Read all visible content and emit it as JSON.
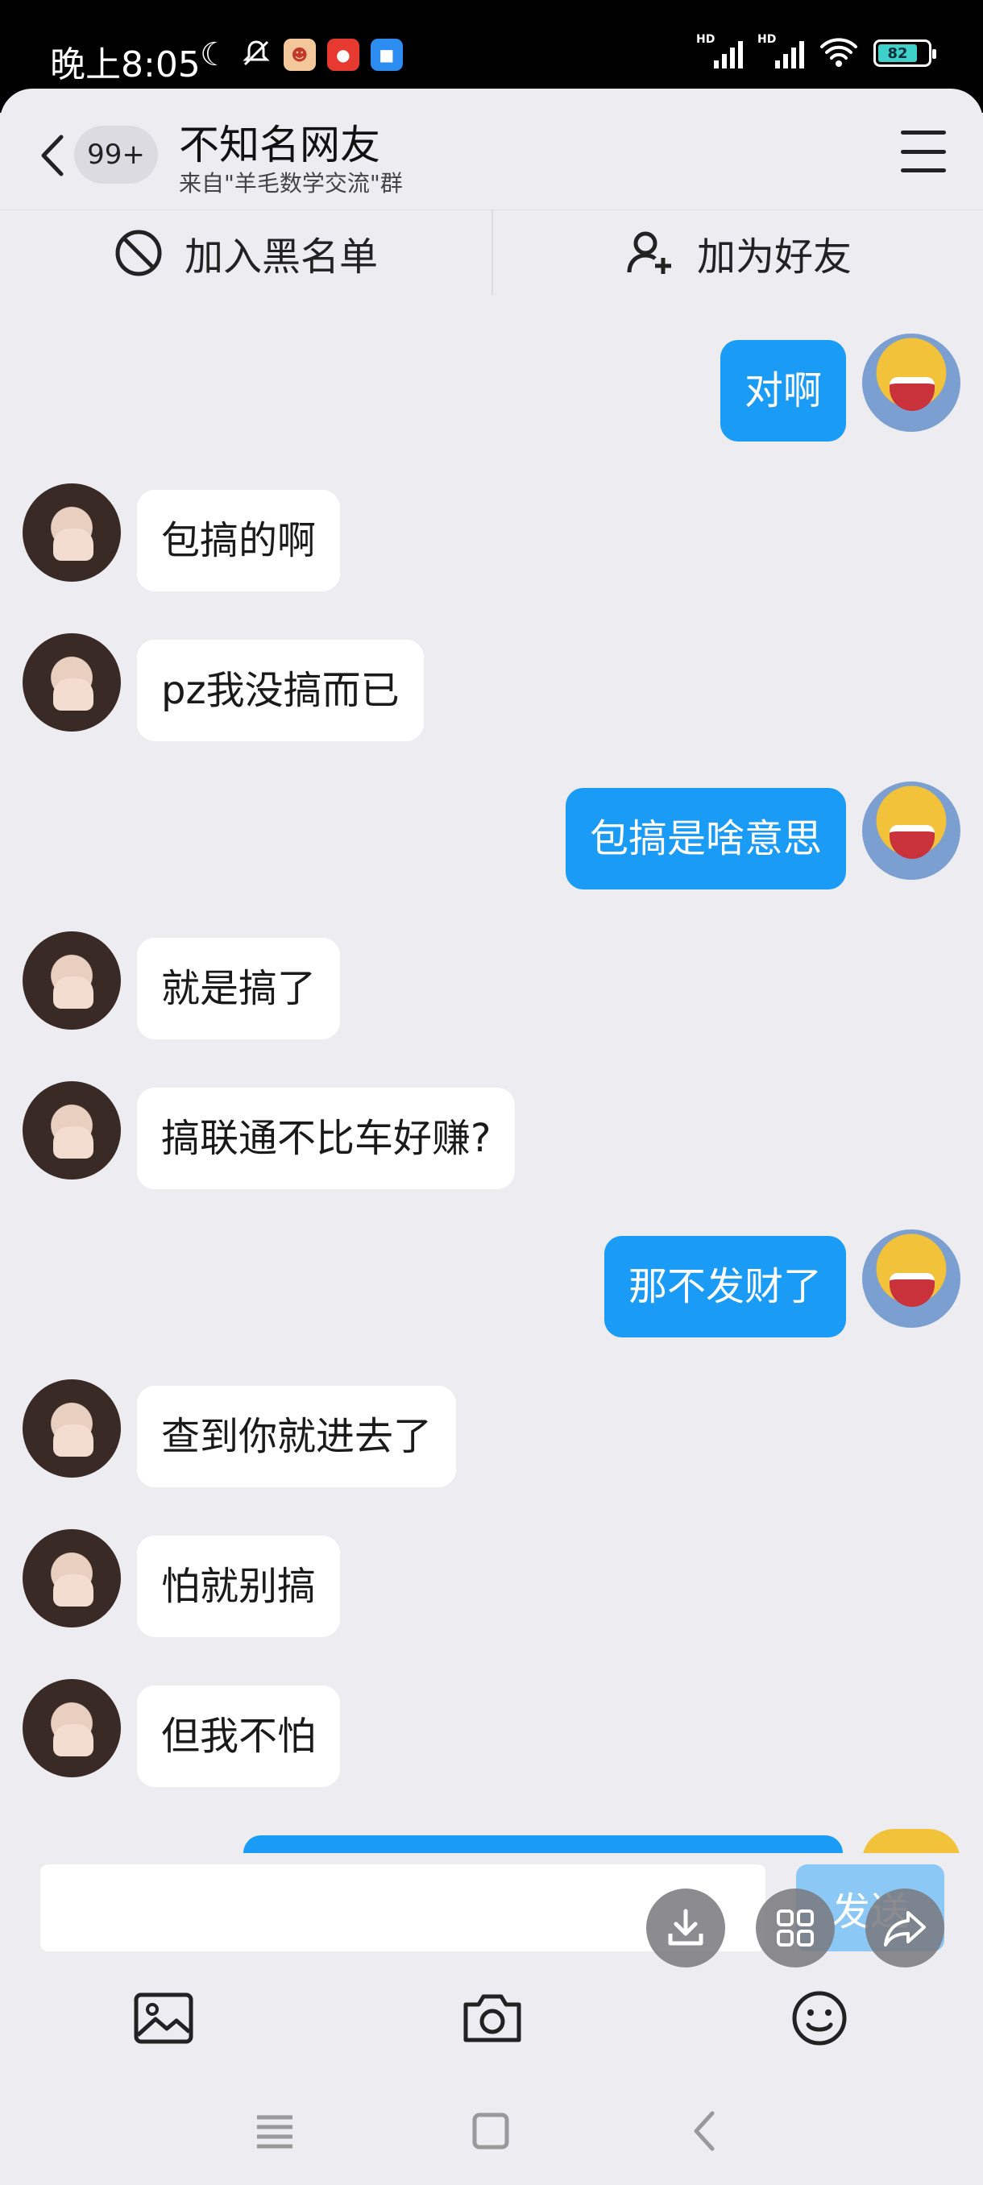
{
  "status_bar": {
    "time": "晚上8:05",
    "hd_label": "HD",
    "battery": "82"
  },
  "header": {
    "unread_badge": "99+",
    "title": "不知名网友",
    "subtitle": "来自\"羊毛数学交流\"群",
    "blacklist_label": "加入黑名单",
    "add_friend_label": "加为好友"
  },
  "messages": [
    {
      "side": "right",
      "text": "对啊"
    },
    {
      "side": "left",
      "text": "包搞的啊"
    },
    {
      "side": "left",
      "text": "pz我没搞而已"
    },
    {
      "side": "right",
      "text": "包搞是啥意思"
    },
    {
      "side": "left",
      "text": "就是搞了"
    },
    {
      "side": "left",
      "text": "搞联通不比车好赚?"
    },
    {
      "side": "right",
      "text": "那不发财了"
    },
    {
      "side": "left",
      "text": "查到你就进去了"
    },
    {
      "side": "left",
      "text": "怕就别搞"
    },
    {
      "side": "left",
      "text": "但我不怕"
    }
  ],
  "input": {
    "value": "",
    "send_label": "发送"
  },
  "colors": {
    "background": "#edecf1",
    "my_bubble": "#1a9bf5",
    "their_bubble": "#ffffff",
    "send_button": "#8cc8f5"
  }
}
